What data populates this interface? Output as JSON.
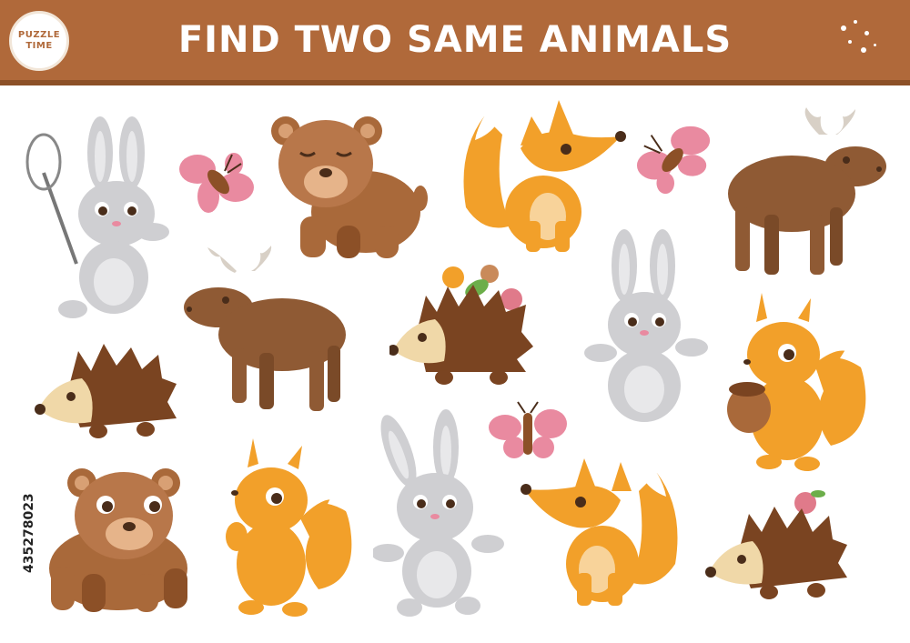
{
  "header": {
    "title": "FIND TWO SAME ANIMALS",
    "logo_line1": "PUZZLE",
    "logo_line2": "TIME",
    "background": "#b0693a"
  },
  "watermark_id": "435278023",
  "colors": {
    "bear": "#a9693a",
    "moose": "#8f5a34",
    "fox": "#f2a02a",
    "squirrel": "#f2a02a",
    "bunny": "#cfcfd2",
    "hedgehog": "#7a4421",
    "butterfly": "#e98aa0"
  },
  "animals": [
    {
      "kind": "bunny",
      "icon": "bunny-icon"
    },
    {
      "kind": "butterfly",
      "icon": "butterfly-icon"
    },
    {
      "kind": "bear",
      "icon": "bear-icon"
    },
    {
      "kind": "fox",
      "icon": "fox-icon"
    },
    {
      "kind": "butterfly",
      "icon": "butterfly-icon"
    },
    {
      "kind": "moose",
      "icon": "moose-icon"
    },
    {
      "kind": "moose",
      "icon": "moose-icon"
    },
    {
      "kind": "hedgehog",
      "icon": "hedgehog-icon"
    },
    {
      "kind": "bunny",
      "icon": "bunny-icon"
    },
    {
      "kind": "hedgehog",
      "icon": "hedgehog-icon"
    },
    {
      "kind": "squirrel",
      "icon": "squirrel-icon"
    },
    {
      "kind": "butterfly",
      "icon": "butterfly-icon"
    },
    {
      "kind": "bear",
      "icon": "bear-icon"
    },
    {
      "kind": "squirrel",
      "icon": "squirrel-icon"
    },
    {
      "kind": "bunny",
      "icon": "bunny-icon"
    },
    {
      "kind": "fox",
      "icon": "fox-icon"
    },
    {
      "kind": "hedgehog",
      "icon": "hedgehog-icon"
    }
  ]
}
